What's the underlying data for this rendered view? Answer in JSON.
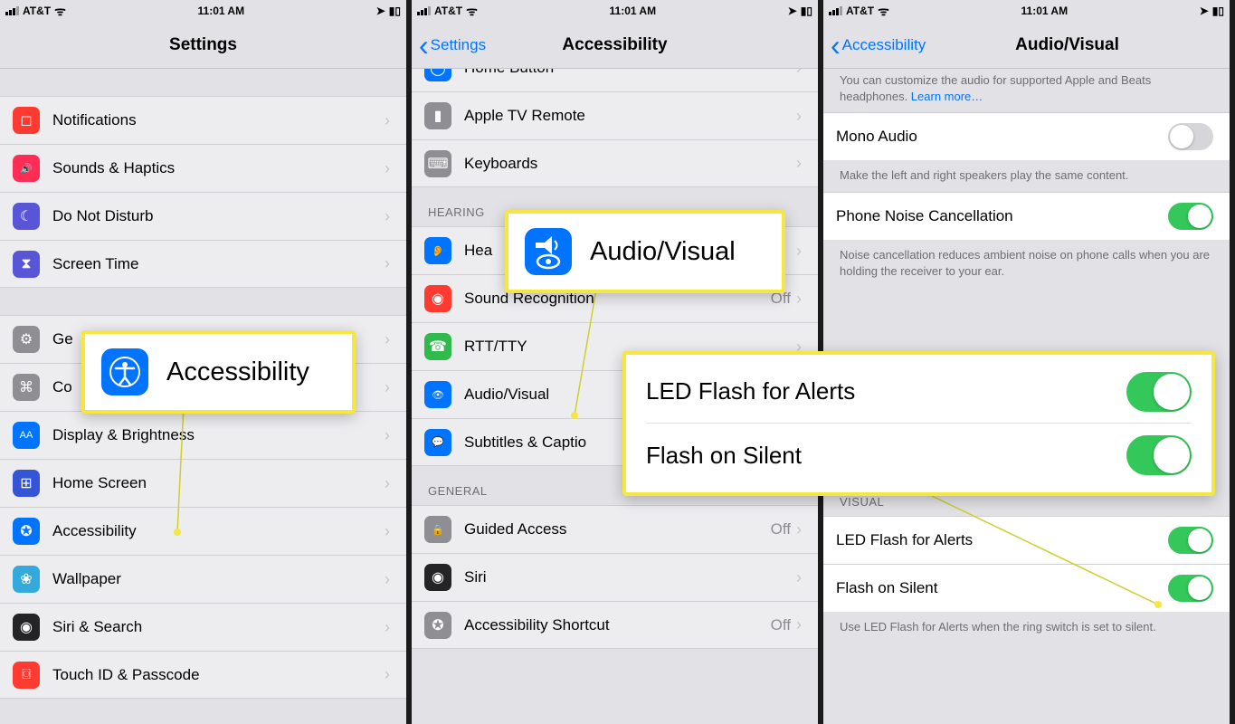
{
  "status": {
    "carrier": "AT&T",
    "time": "11:01 AM"
  },
  "phone1": {
    "title": "Settings",
    "rows_a": [
      {
        "label": "Notifications",
        "color": "#ff3a30",
        "glyph": "◻"
      },
      {
        "label": "Sounds & Haptics",
        "color": "#ff2d55",
        "glyph": "🔊"
      },
      {
        "label": "Do Not Disturb",
        "color": "#5856d6",
        "glyph": "☾"
      },
      {
        "label": "Screen Time",
        "color": "#5856d6",
        "glyph": "⧗"
      }
    ],
    "rows_b": [
      {
        "label": "Ge",
        "glyph": "⚙"
      },
      {
        "label": "Co",
        "glyph": "⌘"
      },
      {
        "label": "Display & Brightness",
        "color": "#0074ff",
        "glyph": "AA"
      },
      {
        "label": "Home Screen",
        "color": "#3455d6",
        "glyph": "⊞"
      },
      {
        "label": "Accessibility",
        "color": "#0074ff",
        "glyph": "✪"
      },
      {
        "label": "Wallpaper",
        "color": "#34aadc",
        "glyph": "❀"
      },
      {
        "label": "Siri & Search",
        "color": "#242426",
        "glyph": "◉"
      },
      {
        "label": "Touch ID & Passcode",
        "color": "#ff3a30",
        "glyph": "⌼"
      }
    ],
    "callout_label": "Accessibility"
  },
  "phone2": {
    "back": "Settings",
    "title": "Accessibility",
    "rows_top": [
      {
        "label": "Home Button",
        "color": "#0074ff",
        "glyph": "◯"
      },
      {
        "label": "Apple TV Remote",
        "glyph": "▮"
      },
      {
        "label": "Keyboards",
        "glyph": "⌨"
      }
    ],
    "sec_hearing": "HEARING",
    "rows_hearing": [
      {
        "label": "Hea",
        "color": "#0074ff",
        "glyph": "👂"
      },
      {
        "label": "Sound Recognition",
        "color": "#ff3a30",
        "value": "Off",
        "glyph": "◉"
      },
      {
        "label": "RTT/TTY",
        "color": "#30b94c",
        "glyph": "☎"
      },
      {
        "label": "Audio/Visual",
        "color": "#0074ff",
        "glyph": "👁"
      },
      {
        "label": "Subtitles & Captio",
        "color": "#0074ff",
        "glyph": "💬"
      }
    ],
    "sec_general": "GENERAL",
    "rows_general": [
      {
        "label": "Guided Access",
        "value": "Off",
        "glyph": "🔒"
      },
      {
        "label": "Siri",
        "color": "#242426",
        "glyph": "◉"
      },
      {
        "label": "Accessibility Shortcut",
        "value": "Off",
        "glyph": "✪"
      }
    ],
    "callout_label": "Audio/Visual"
  },
  "phone3": {
    "back": "Accessibility",
    "title": "Audio/Visual",
    "intro": "You can customize the audio for supported Apple and Beats headphones. ",
    "learn": "Learn more…",
    "mono_label": "Mono Audio",
    "mono_note": "Make the left and right speakers play the same content.",
    "noise_label": "Phone Noise Cancellation",
    "noise_note": "Noise cancellation reduces ambient noise on phone calls when you are holding the receiver to your ear.",
    "sec_visual": "VISUAL",
    "led_label": "LED Flash for Alerts",
    "silent_label": "Flash on Silent",
    "silent_note": "Use LED Flash for Alerts when the ring switch is set to silent.",
    "callout_led": "LED Flash for Alerts",
    "callout_silent": "Flash on Silent"
  }
}
